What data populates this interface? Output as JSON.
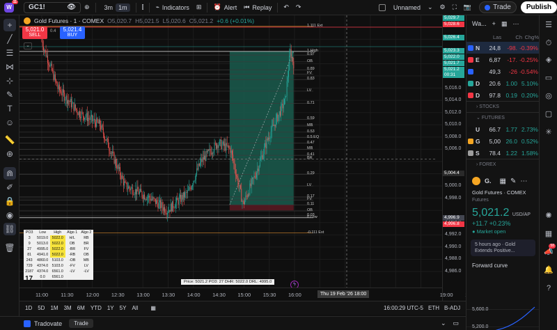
{
  "topbar": {
    "logo_letter": "W",
    "logo_badge": "11",
    "symbol": "GC1!",
    "timeframes": [
      "3m",
      "1m"
    ],
    "indicators_label": "Indicators",
    "alert_label": "Alert",
    "replay_label": "Replay",
    "layout_name": "Unnamed",
    "trade_label": "Trade",
    "publish_label": "Publish"
  },
  "chart": {
    "title": "Gold Futures · 1 · COMEX",
    "ohlc": {
      "open": "O5,020.7",
      "high": "H5,021.5",
      "low": "L5,020.6",
      "close": "C5,021.2",
      "change": "+0.6 (+0.01%)"
    },
    "sell": {
      "price": "5,021.0",
      "label": "SELL"
    },
    "buy": {
      "price": "5,021.4",
      "label": "BUY"
    },
    "spread": "0.4",
    "fib_levels": [
      {
        "label": "1.111 Ext",
        "price": 5026.1
      },
      {
        "label": "1 High",
        "price": 5022.0
      },
      {
        "label": "0.97",
        "price": 5021.4
      },
      {
        "label": "OB",
        "price": 5020.3
      },
      {
        "label": "0.89",
        "price": 5019.0
      },
      {
        "label": "FV",
        "price": 5018.3
      },
      {
        "label": "0.83",
        "price": 5017.4
      },
      {
        "label": "LV",
        "price": 5015.5
      },
      {
        "label": "0.71",
        "price": 5013.5
      },
      {
        "label": "0.59",
        "price": 5010.9
      },
      {
        "label": "MB",
        "price": 5009.8
      },
      {
        "label": "0.53",
        "price": 5008.8
      },
      {
        "label": "0.5 EQ",
        "price": 5007.9
      },
      {
        "label": "0.47",
        "price": 5007.0
      },
      {
        "label": "MB",
        "price": 5006.0
      },
      {
        "label": "0.41",
        "price": 5005.0
      },
      {
        "label": "BR",
        "price": 5004.4
      },
      {
        "label": "0.29",
        "price": 5001.9
      },
      {
        "label": "LV",
        "price": 5000.0
      },
      {
        "label": "0.17",
        "price": 4998.2
      },
      {
        "label": "FV",
        "price": 4997.7
      },
      {
        "label": "0.11",
        "price": 4996.9
      },
      {
        "label": "OB",
        "price": 4995.9
      },
      {
        "label": "0.03",
        "price": 4995.1
      },
      {
        "label": "0 Low",
        "price": 4994.8
      },
      {
        "label": "-0.111 Ext",
        "price": 4992.3
      }
    ],
    "stats_table": {
      "headers": [
        "PO3",
        "Low",
        "High",
        "Algo 1",
        "Algo 2"
      ],
      "rows": [
        [
          "3",
          "5019.0",
          "5022.0",
          "H/L",
          "RB"
        ],
        [
          "9",
          "5013.0",
          "5022.0",
          "OB",
          "BR"
        ],
        [
          "27",
          "4995.0",
          "5022.0",
          "-BR",
          "FV"
        ],
        [
          "81",
          "4941.0",
          "5022.0",
          "-RB",
          "OB"
        ],
        [
          "243",
          "4860.0",
          "5103.0",
          "-OB",
          "MB"
        ],
        [
          "729",
          "4374.0",
          "5103.0",
          "-FV",
          "LV"
        ],
        [
          "2187",
          "4374.0",
          "6561.0",
          "-LV",
          "-LV"
        ],
        [
          "",
          "0.0",
          "6561.0",
          "",
          ""
        ]
      ],
      "logo": "17"
    },
    "info_bar": "Price: 5021.2   PO3: 27   DHR: 5022.0   DRL: 4995.0",
    "position_tool": {
      "entry": 4996.9,
      "target": 5022.0,
      "stop": 4996.0,
      "start_time": "14:43",
      "end_time": "15:59"
    }
  },
  "price_axis": {
    "ticks": [
      "5,018.0",
      "5,016.0",
      "5,014.0",
      "5,012.0",
      "5,010.0",
      "5,008.0",
      "5,006.0",
      "5,002.0",
      "5,000.0",
      "4,998.0",
      "4,994.0",
      "4,992.0",
      "4,990.0",
      "4,988.0",
      "4,986.0"
    ],
    "tags": [
      {
        "text": "5,029.7",
        "color": "#26a69a"
      },
      {
        "text": "5,028.6",
        "color": "#f23645"
      },
      {
        "text": "5,026.4",
        "color": "#26a69a"
      },
      {
        "text": "5,023.3",
        "color": "#26a69a"
      },
      {
        "text": "5,022.0",
        "color": "#26a69a"
      },
      {
        "text": "5,021.7",
        "color": "#26a69a"
      },
      {
        "text": "5,021.2",
        "color": "#26a69a"
      },
      {
        "text": "00:31",
        "color": "#26a69a"
      },
      {
        "text": "5,004.4",
        "color": "#2a2a2a"
      },
      {
        "text": "4,996.9",
        "color": "#434651"
      },
      {
        "text": "4,996.8",
        "color": "#f23645"
      }
    ]
  },
  "time_axis": {
    "ticks": [
      "11:00",
      "11:30",
      "12:00",
      "12:30",
      "13:00",
      "13:30",
      "14:00",
      "14:30",
      "15:00",
      "15:30",
      "16:00",
      "18:00",
      "19:00",
      "19:30"
    ],
    "crosshair": "Thu 19 Feb '26   18:00"
  },
  "range_bar": {
    "ranges": [
      "1D",
      "5D",
      "1M",
      "3M",
      "6M",
      "YTD",
      "1Y",
      "5Y",
      "All"
    ],
    "clock": "16:00:29 UTC-5",
    "session": "ETH",
    "adjust": "B-ADJ"
  },
  "footer": {
    "broker": "Tradovate",
    "trade_label": "Trade"
  },
  "watchlist": {
    "title": "Wa...",
    "columns": [
      "Las",
      "Ch",
      "Chg%"
    ],
    "rows": [
      {
        "sym": "N",
        "last": "24,8",
        "ch": "-98.",
        "pct": "-0.39%",
        "dir": "down",
        "icon": "#2962ff",
        "selected": true
      },
      {
        "sym": "E",
        "last": "6,87",
        "ch": "-17.",
        "pct": "-0.25%",
        "dir": "down",
        "icon": "#f23645"
      },
      {
        "sym": "",
        "last": "49,3",
        "ch": "-26",
        "pct": "-0.54%",
        "dir": "down",
        "icon": "#2962ff"
      },
      {
        "sym": "D",
        "last": "20.6",
        "ch": "1.00",
        "pct": "5.10%",
        "dir": "up",
        "icon": "#26a69a"
      },
      {
        "sym": "D",
        "last": "97.8",
        "ch": "0.19",
        "pct": "0.20%",
        "dir": "up",
        "icon": "#f23645"
      }
    ],
    "sections": {
      "stocks": "STOCKS",
      "futures": "FUTURES",
      "forex": "FOREX"
    },
    "futures_rows": [
      {
        "sym": "U",
        "last": "66.7",
        "ch": "1.77",
        "pct": "2.73%",
        "dir": "up",
        "icon": "#111"
      },
      {
        "sym": "G",
        "last": "5,00",
        "ch": "26.0",
        "pct": "0.52%",
        "dir": "up",
        "icon": "#f5a623"
      },
      {
        "sym": "S",
        "last": "78.4",
        "ch": "1.22",
        "pct": "1.58%",
        "dir": "up",
        "icon": "#9e9e9e"
      }
    ]
  },
  "detail": {
    "short": "G.",
    "name": "Gold Futures",
    "exchange": "· COMEX",
    "sub": "Futures",
    "price": "5,021.2",
    "unit": "USD/AP",
    "change": "+11.7  +0.23%",
    "market_status": "Market open",
    "news": "5 hours ago · Gold Extends Positive...",
    "forward_curve_title": "Forward curve",
    "forward_labels": [
      "5,600.0",
      "5,200.0"
    ],
    "forward_points": [
      5030,
      5045,
      5060,
      5075,
      5090,
      5110,
      5140,
      5170,
      5210,
      5260,
      5320,
      5390,
      5470,
      5560,
      5650
    ]
  },
  "farright": {
    "badge": "58"
  }
}
